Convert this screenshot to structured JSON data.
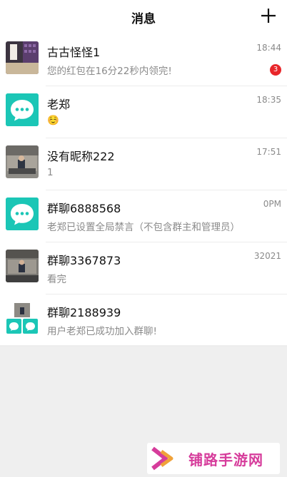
{
  "header": {
    "title": "消息",
    "add_icon": "plus-icon"
  },
  "conversations": [
    {
      "name": "古古怪怪1",
      "preview": "您的红包在16分22秒内领完!",
      "time": "18:44",
      "badge": "3",
      "avatar": "photo-keyboard"
    },
    {
      "name": "老郑",
      "preview": "☺️",
      "time": "18:35",
      "badge": "",
      "avatar": "chat-bubble-icon"
    },
    {
      "name": "没有昵称222",
      "preview": "1",
      "time": "17:51",
      "badge": "",
      "avatar": "photo-room"
    },
    {
      "name": "群聊6888568",
      "preview": "老郑已设置全局禁言（不包含群主和管理员）",
      "time": "0PM",
      "badge": "",
      "avatar": "chat-bubble-icon"
    },
    {
      "name": "群聊3367873",
      "preview": "看完",
      "time": "32021",
      "badge": "",
      "avatar": "photo-room"
    },
    {
      "name": "群聊2188939",
      "preview": "用户老郑已成功加入群聊!",
      "time": "",
      "badge": "",
      "avatar": "group-collage"
    }
  ],
  "watermark": {
    "text": "铺路手游网"
  },
  "colors": {
    "accent": "#1bc6b6",
    "badge": "#e8262a",
    "watermark": "#d63c9b"
  }
}
